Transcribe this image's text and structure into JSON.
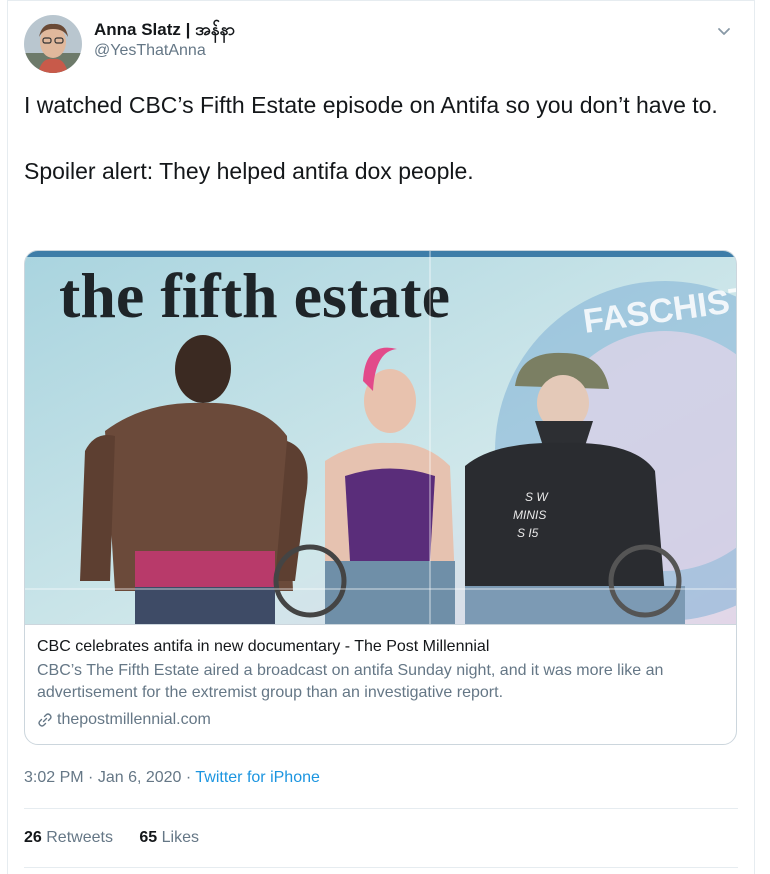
{
  "user": {
    "display_name": "Anna Slatz | အန်နာ",
    "handle": "@YesThatAnna"
  },
  "tweet": {
    "text": "I watched CBC’s Fifth Estate episode on Antifa so you don’t have to.\n\nSpoiler alert: They helped antifa dox people."
  },
  "card": {
    "image_headline": "the fifth estate",
    "image_banner": "FASCHIST",
    "image_shirt_text": "S W\nMINIS\nS I5",
    "title": "CBC celebrates antifa in new documentary - The Post Millennial",
    "description": "CBC’s The Fifth Estate aired a broadcast on antifa Sunday night, and it was more like an advertisement for the extremist group than an investigative report.",
    "domain": "thepostmillennial.com"
  },
  "meta": {
    "time": "3:02 PM",
    "date": "Jan 6, 2020",
    "separator": "·",
    "source": "Twitter for iPhone"
  },
  "stats": {
    "retweets_count": "26",
    "retweets_label": "Retweets",
    "likes_count": "65",
    "likes_label": "Likes"
  },
  "icons": {
    "caret": "chevron-down-icon",
    "link": "link-icon"
  },
  "colors": {
    "link_blue": "#1b95e0",
    "secondary_text": "#657786",
    "border": "#ccd6dd"
  }
}
